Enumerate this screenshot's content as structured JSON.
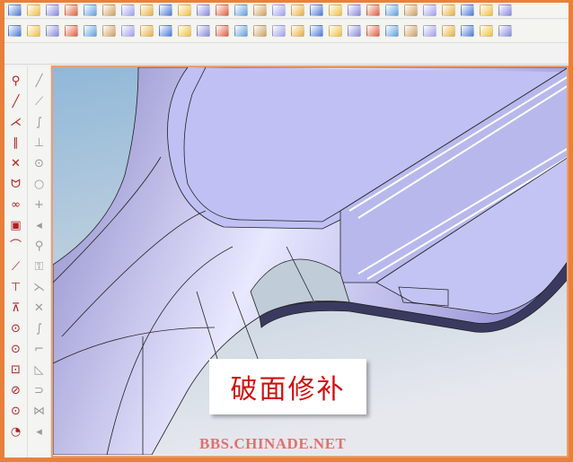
{
  "toolbar_top": {
    "icons": [
      "solid-box-icon",
      "sphere-icon",
      "extrude-icon",
      "sweep-icon",
      "loft-icon",
      "cut-icon",
      "cylinder-icon",
      "wall-icon",
      "cube-icon",
      "shell-icon",
      "fillet-icon",
      "chamfer-icon",
      "draft-icon",
      "blend-icon",
      "boolean-icon",
      "split-icon",
      "pattern-icon",
      "mirror-icon",
      "scale-icon",
      "offset-icon",
      "thicken-icon",
      "trim-icon",
      "extend-icon",
      "sew-icon",
      "patch-icon",
      "face-icon",
      "delete-icon"
    ]
  },
  "toolbar_surface": {
    "icons": [
      "plane-surface-icon",
      "ruled-surface-icon",
      "extrude-surface-icon",
      "revolve-surface-icon",
      "sweep-surface-icon",
      "boundary-surface-icon",
      "blend-surface-icon",
      "offset-surface-icon",
      "fill-surface-icon",
      "net-surface-icon",
      "trim-surface-icon",
      "extend-surface-icon",
      "untrim-icon",
      "match-surface-icon",
      "fillet-surface-icon",
      "chamfer-surface-icon",
      "split-surface-icon",
      "join-surface-icon",
      "patch-icon",
      "knit-icon",
      "draft-surface-icon",
      "normal-icon",
      "flip-icon",
      "analysis-icon",
      "zebra-icon",
      "curvature-icon",
      "thickness-icon"
    ]
  },
  "sidebar_curves": {
    "icons": [
      "select-icon",
      "line-icon",
      "axis-icon",
      "parallel-line-icon",
      "perpendicular-icon",
      "arc-icon",
      "circle-icon",
      "rectangle-icon",
      "spline-icon",
      "polyline-icon",
      "trim-curve-icon",
      "extend-curve-icon",
      "center-circle-icon",
      "tangent-circle-icon",
      "box-circle-icon",
      "three-point-circle-icon",
      "point-circle-icon",
      "arc-point-icon"
    ]
  },
  "sidebar_sketch": {
    "icons": [
      "line-2d-icon",
      "angled-line-icon",
      "curve-2d-icon",
      "tangent-icon",
      "point-circle-icon",
      "circle-2d-icon",
      "cross-icon",
      "more-icon",
      "project-icon",
      "reference-icon",
      "bridge-curve-icon",
      "intersect-icon",
      "spline-2d-icon",
      "fillet-curve-icon",
      "chamfer-curve-icon",
      "offset-curve-icon",
      "blend-curve-icon",
      "more-icon"
    ]
  },
  "caption": "破面修补",
  "watermark": "BBS.CHINADE.NET"
}
